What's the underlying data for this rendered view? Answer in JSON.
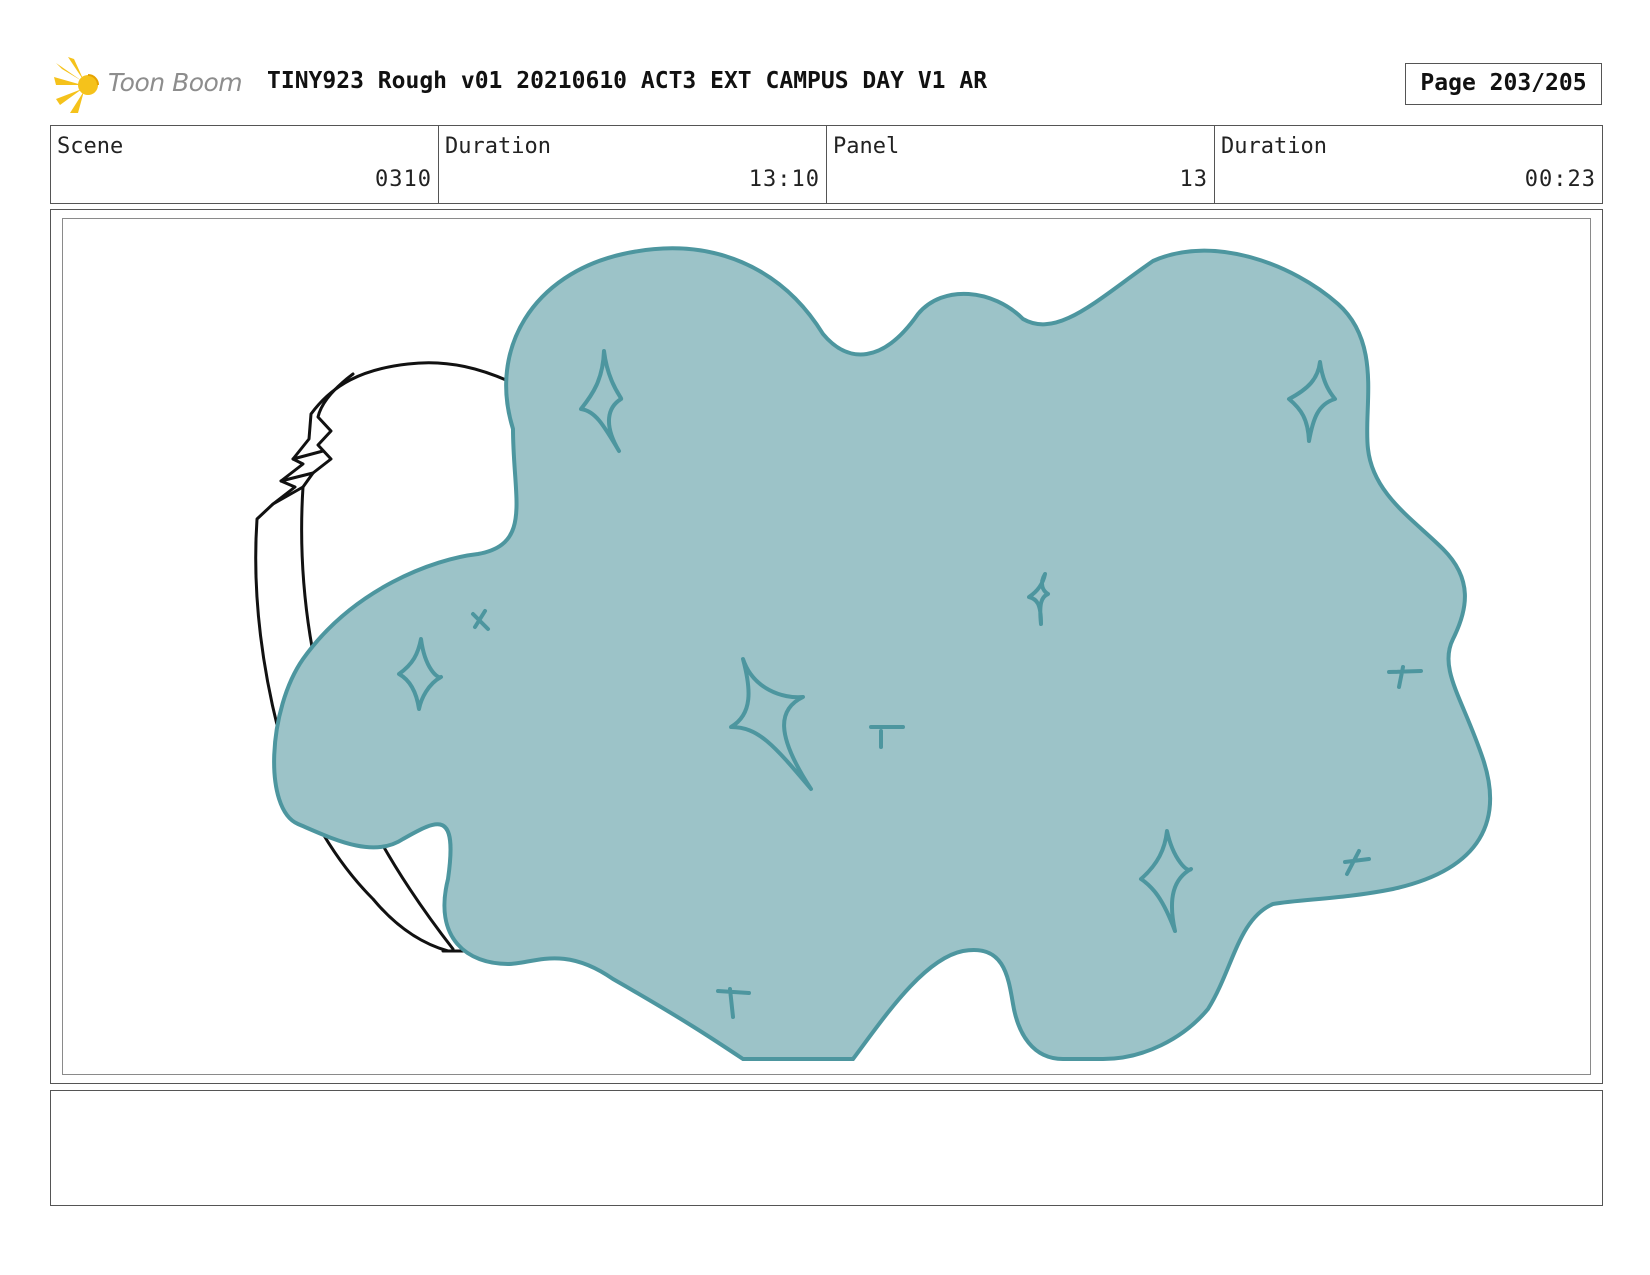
{
  "header": {
    "logo_text": "Toon Boom",
    "title": "TINY923 Rough v01 20210610 ACT3 EXT CAMPUS DAY V1 AR",
    "page_label": "Page 203/205"
  },
  "info": [
    {
      "label": "Scene",
      "value": "0310"
    },
    {
      "label": "Duration",
      "value": "13:10"
    },
    {
      "label": "Panel",
      "value": "13"
    },
    {
      "label": "Duration",
      "value": "00:23"
    }
  ],
  "notes": {
    "text": ""
  },
  "colors": {
    "cloud_fill": "#9cc3c8",
    "cloud_stroke": "#4d969f",
    "logo_flare": "#f5c21b"
  }
}
